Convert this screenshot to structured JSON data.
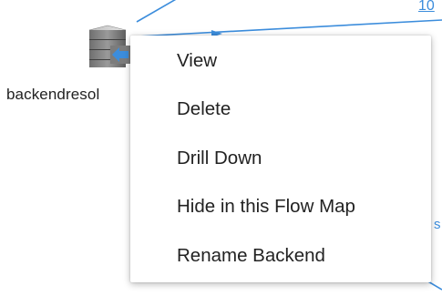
{
  "flow_map": {
    "node": {
      "label": "backendresol",
      "icon": "database-server-icon"
    },
    "edge_labels": {
      "top": "10",
      "side": "s"
    },
    "colors": {
      "edge": "#3c8ddc"
    }
  },
  "context_menu": {
    "items": [
      {
        "label": "View"
      },
      {
        "label": "Delete"
      },
      {
        "label": "Drill Down"
      },
      {
        "label": "Hide in this Flow Map"
      },
      {
        "label": "Rename Backend"
      }
    ]
  }
}
